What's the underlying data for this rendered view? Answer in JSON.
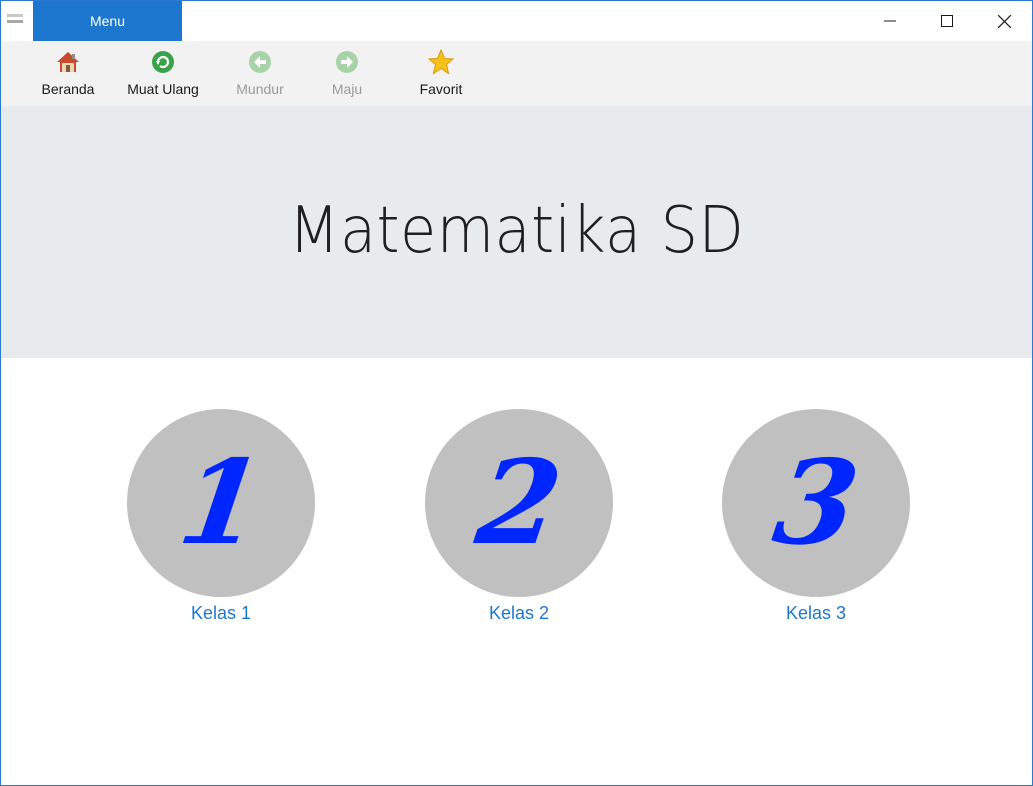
{
  "titlebar": {
    "menu_label": "Menu",
    "logo_icon": "app-logo-icon",
    "controls": {
      "minimize_icon": "minimize-icon",
      "maximize_icon": "maximize-icon",
      "close_icon": "close-icon"
    }
  },
  "toolbar": {
    "items": [
      {
        "label": "Beranda",
        "icon": "home-icon",
        "enabled": true
      },
      {
        "label": "Muat Ulang",
        "icon": "refresh-icon",
        "enabled": true
      },
      {
        "label": "Mundur",
        "icon": "back-arrow-icon",
        "enabled": false
      },
      {
        "label": "Maju",
        "icon": "forward-arrow-icon",
        "enabled": false
      },
      {
        "label": "Favorit",
        "icon": "star-icon",
        "enabled": true
      }
    ]
  },
  "hero": {
    "title": "Matematika SD"
  },
  "grades": [
    {
      "number": "1",
      "label": "Kelas 1"
    },
    {
      "number": "2",
      "label": "Kelas 2"
    },
    {
      "number": "3",
      "label": "Kelas 3"
    }
  ],
  "colors": {
    "accent": "#1d77cf",
    "numeral": "#0026ff",
    "circle": "#c0c0c0",
    "hero_bg": "#e8ebee",
    "toolbar_bg": "#f2f2f2"
  }
}
